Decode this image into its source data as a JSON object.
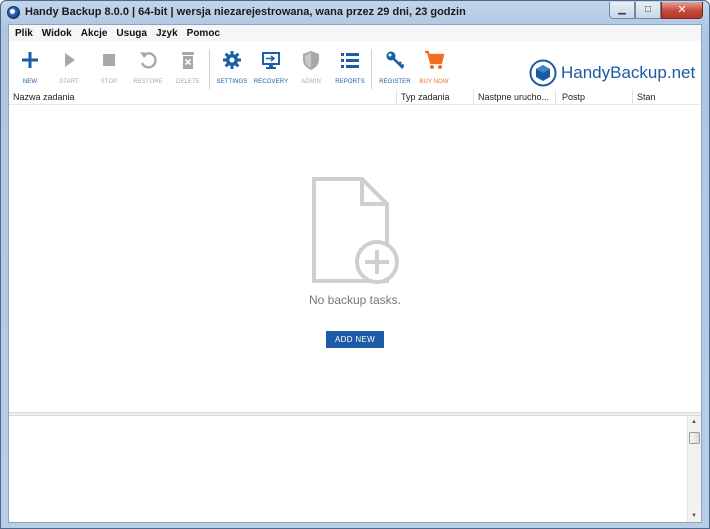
{
  "window": {
    "title": "Handy Backup 8.0.0 | 64-bit | wersja niezarejestrowana, wana przez  29 dni, 23 godzin"
  },
  "menu": [
    "Plik",
    "Widok",
    "Akcje",
    "Usuga",
    "Jzyk",
    "Pomoc"
  ],
  "toolbar": {
    "new": "NEW",
    "start": "START",
    "stop": "STOP",
    "restore": "RESTORE",
    "delete": "DELETE",
    "settings": "SETTINGS",
    "recovery": "RECOVERY",
    "admin": "ADMIN",
    "reports": "REPORTS",
    "register": "REGISTER",
    "buy_now": "BUY NOW"
  },
  "logo": {
    "text": "HandyBackup.net"
  },
  "columns": [
    "Nazwa zadania",
    "Typ zadania",
    "Nastpne urucho...",
    "Postp",
    "Stan"
  ],
  "empty_state": {
    "message": "No backup tasks.",
    "button": "ADD NEW"
  },
  "colors": {
    "accent": "#1d5ca4",
    "disabled": "#a8a8a8",
    "buy": "#f26d21"
  }
}
